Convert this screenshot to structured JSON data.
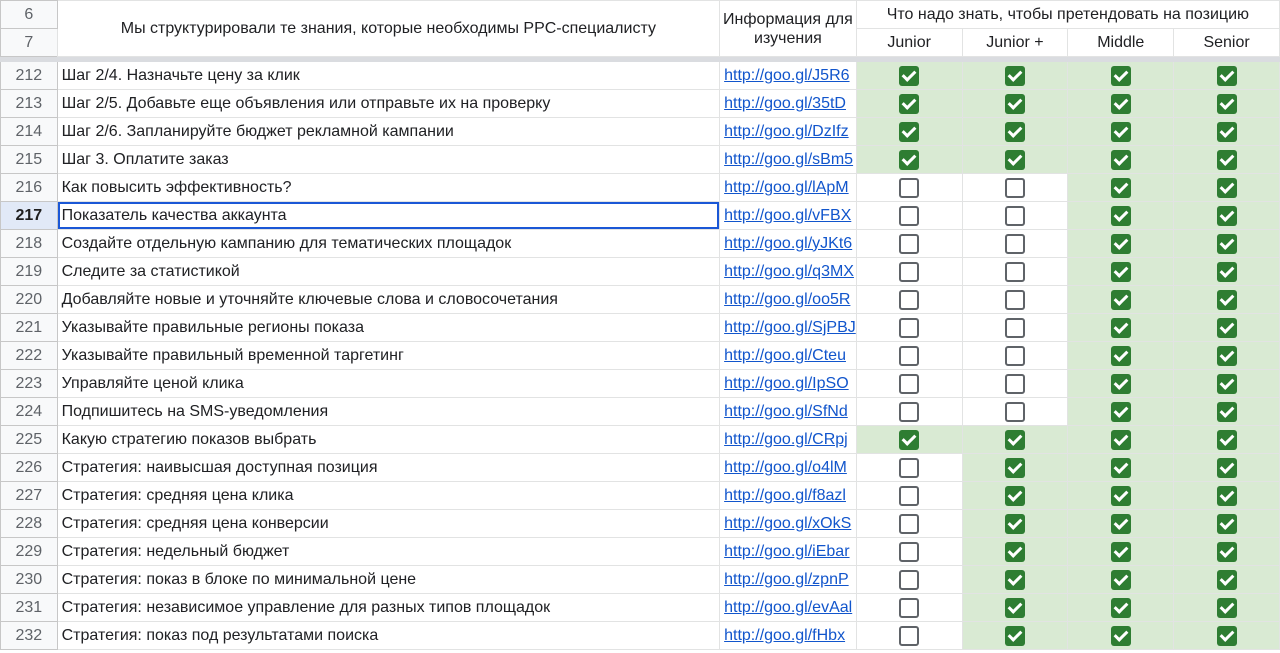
{
  "header": {
    "row6": "6",
    "row7": "7",
    "title": "Мы структурировали те знания, которые необходимы PPC-специалисту",
    "info": "Информация для изучения",
    "positions": "Что надо знать, чтобы претендовать на позицию",
    "levels": [
      "Junior",
      "Junior +",
      "Middle",
      "Senior"
    ]
  },
  "rows": [
    {
      "num": "212",
      "topic": "Шаг 2/4. Назначьте цену за клик",
      "link": "http://goo.gl/J5R6",
      "checks": [
        1,
        1,
        1,
        1
      ]
    },
    {
      "num": "213",
      "topic": "Шаг 2/5. Добавьте еще объявления или отправьте их на проверку",
      "link": "http://goo.gl/35tD",
      "checks": [
        1,
        1,
        1,
        1
      ]
    },
    {
      "num": "214",
      "topic": "Шаг 2/6. Запланируйте бюджет рекламной кампании",
      "link": "http://goo.gl/DzIfz",
      "checks": [
        1,
        1,
        1,
        1
      ]
    },
    {
      "num": "215",
      "topic": "Шаг 3. Оплатите заказ",
      "link": "http://goo.gl/sBm5",
      "checks": [
        1,
        1,
        1,
        1
      ]
    },
    {
      "num": "216",
      "topic": "Как повысить эффективность?",
      "link": "http://goo.gl/lApM",
      "checks": [
        0,
        0,
        1,
        1
      ]
    },
    {
      "num": "217",
      "topic": "Показатель качества аккаунта",
      "link": "http://goo.gl/vFBX",
      "checks": [
        0,
        0,
        1,
        1
      ]
    },
    {
      "num": "218",
      "topic": "Создайте отдельную кампанию для тематических площадок",
      "link": "http://goo.gl/yJKt6",
      "checks": [
        0,
        0,
        1,
        1
      ]
    },
    {
      "num": "219",
      "topic": "Следите за статистикой",
      "link": "http://goo.gl/q3MX",
      "checks": [
        0,
        0,
        1,
        1
      ]
    },
    {
      "num": "220",
      "topic": "Добавляйте новые и уточняйте ключевые слова и словосочетания",
      "link": "http://goo.gl/oo5R",
      "checks": [
        0,
        0,
        1,
        1
      ]
    },
    {
      "num": "221",
      "topic": "Указывайте правильные регионы показа",
      "link": "http://goo.gl/SjPBJ",
      "checks": [
        0,
        0,
        1,
        1
      ]
    },
    {
      "num": "222",
      "topic": "Указывайте правильный временной таргетинг",
      "link": "http://goo.gl/Cteu",
      "checks": [
        0,
        0,
        1,
        1
      ]
    },
    {
      "num": "223",
      "topic": "Управляйте ценой клика",
      "link": "http://goo.gl/IpSO",
      "checks": [
        0,
        0,
        1,
        1
      ]
    },
    {
      "num": "224",
      "topic": "Подпишитесь на SMS-уведомления",
      "link": "http://goo.gl/SfNd",
      "checks": [
        0,
        0,
        1,
        1
      ]
    },
    {
      "num": "225",
      "topic": "Какую стратегию показов выбрать",
      "link": "http://goo.gl/CRpj",
      "checks": [
        1,
        1,
        1,
        1
      ]
    },
    {
      "num": "226",
      "topic": "Стратегия: наивысшая доступная позиция",
      "link": "http://goo.gl/o4lM",
      "checks": [
        0,
        1,
        1,
        1
      ]
    },
    {
      "num": "227",
      "topic": "Стратегия: средняя цена клика",
      "link": "http://goo.gl/f8azl",
      "checks": [
        0,
        1,
        1,
        1
      ]
    },
    {
      "num": "228",
      "topic": "Стратегия: средняя цена конверсии",
      "link": "http://goo.gl/xOkS",
      "checks": [
        0,
        1,
        1,
        1
      ]
    },
    {
      "num": "229",
      "topic": "Стратегия: недельный бюджет",
      "link": "http://goo.gl/iEbar",
      "checks": [
        0,
        1,
        1,
        1
      ]
    },
    {
      "num": "230",
      "topic": "Стратегия: показ в блоке по минимальной цене",
      "link": "http://goo.gl/zpnP",
      "checks": [
        0,
        1,
        1,
        1
      ]
    },
    {
      "num": "231",
      "topic": "Стратегия: независимое управление для разных типов площадок",
      "link": "http://goo.gl/evAal",
      "checks": [
        0,
        1,
        1,
        1
      ]
    },
    {
      "num": "232",
      "topic": "Стратегия: показ под результатами поиска",
      "link": "http://goo.gl/fHbx",
      "checks": [
        0,
        1,
        1,
        1
      ]
    }
  ],
  "selected_row": "217",
  "colors": {
    "check_green": "#2e7d32",
    "cell_green": "#d9ead3",
    "link": "#1155cc",
    "selection": "#1a57d6"
  }
}
